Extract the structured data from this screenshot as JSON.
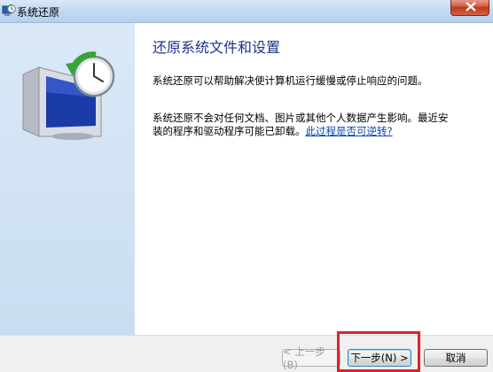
{
  "window": {
    "title": "系统还原",
    "icon": "system-restore-icon",
    "close_icon": "close-icon"
  },
  "content": {
    "heading": "还原系统文件和设置",
    "paragraph1": "系统还原可以帮助解决使计算机运行缓慢或停止响应的问题。",
    "paragraph2": "系统还原不会对任何文档、图片或其他个人数据产生影响。最近安装的程序和驱动程序可能已卸载。",
    "link": "此过程是否可逆转?"
  },
  "buttons": {
    "back": "< 上一步(B)",
    "next": "下一步(N) >",
    "cancel": "取消"
  },
  "colors": {
    "heading": "#1e3287",
    "link": "#0645ad",
    "highlight": "#e0202a"
  }
}
